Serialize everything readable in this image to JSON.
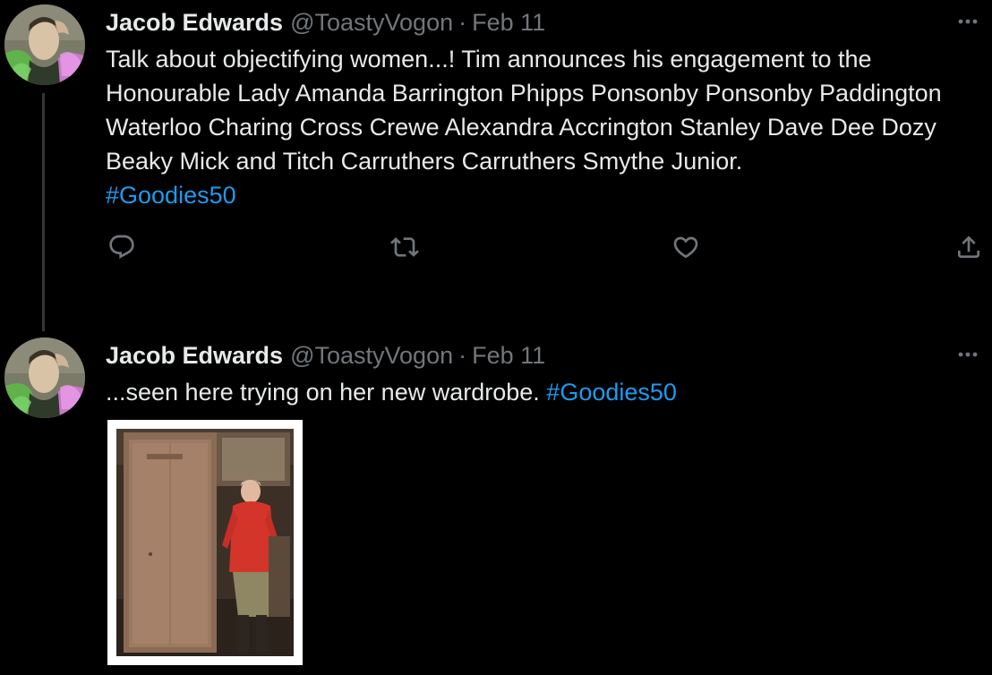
{
  "tweets": [
    {
      "author_name": "Jacob Edwards",
      "author_handle": "@ToastyVogon",
      "separator": "·",
      "date": "Feb 11",
      "text": "Talk about objectifying women...! Tim announces his engagement to the Honourable Lady Amanda Barrington Phipps Ponsonby Ponsonby Paddington Waterloo Charing Cross Crewe Alexandra Accrington Stanley Dave Dee Dozy Beaky Mick and Titch Carruthers Carruthers Smythe Junior.",
      "hashtag": "#Goodies50"
    },
    {
      "author_name": "Jacob Edwards",
      "author_handle": "@ToastyVogon",
      "separator": "·",
      "date": "Feb 11",
      "text": "...seen here trying on her new wardrobe.",
      "hashtag": "#Goodies50"
    }
  ],
  "icons": {
    "reply": "reply-icon",
    "retweet": "retweet-icon",
    "like": "heart-icon",
    "share": "share-icon",
    "more": "more-icon"
  },
  "colors": {
    "background": "#000000",
    "text": "#e7e9ea",
    "secondary": "#71767b",
    "link": "#1d9bf0",
    "thread_line": "#333639"
  }
}
